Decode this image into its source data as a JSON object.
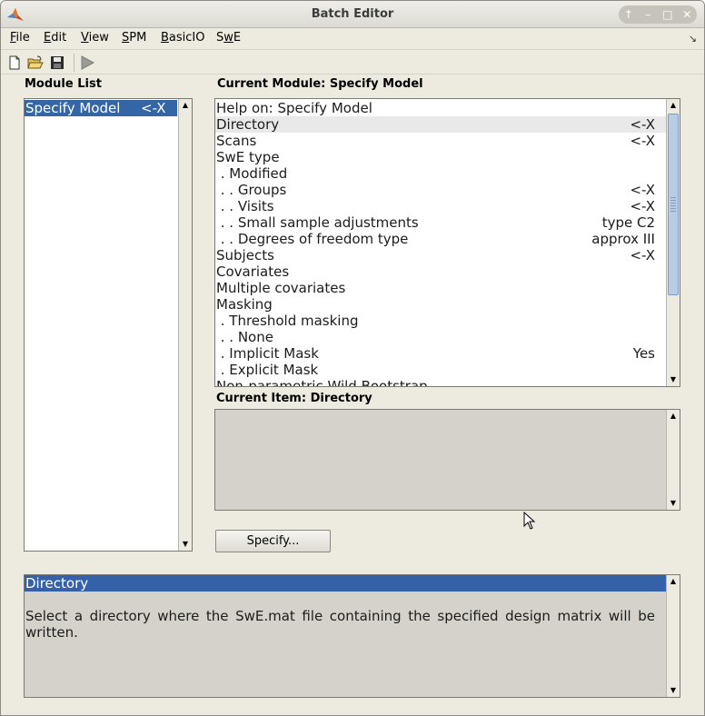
{
  "window": {
    "title": "Batch Editor",
    "controls": [
      "up-icon",
      "minimize-icon",
      "maximize-icon",
      "close-icon"
    ]
  },
  "menubar": {
    "items": [
      {
        "pre": "",
        "u": "F",
        "post": "ile"
      },
      {
        "pre": "",
        "u": "E",
        "post": "dit"
      },
      {
        "pre": "",
        "u": "V",
        "post": "iew"
      },
      {
        "pre": "",
        "u": "S",
        "post": "PM"
      },
      {
        "pre": "",
        "u": "B",
        "post": "asicIO"
      },
      {
        "pre": "S",
        "u": "w",
        "post": "E"
      }
    ]
  },
  "toolbar": {
    "icons": [
      "new-file-icon",
      "open-folder-icon",
      "save-icon",
      "run-icon"
    ]
  },
  "module_list": {
    "label": "Module List",
    "items": [
      {
        "label": "Specify Model",
        "value": "<-X",
        "selected": true
      }
    ]
  },
  "current_module": {
    "label": "Current Module: Specify Model",
    "rows": [
      {
        "label": "Help on: Specify Model",
        "value": ""
      },
      {
        "label": "Directory",
        "value": "<-X",
        "selected": true
      },
      {
        "label": "Scans",
        "value": "<-X"
      },
      {
        "label": "SwE type",
        "value": ""
      },
      {
        "label": " . Modified",
        "value": ""
      },
      {
        "label": " . . Groups",
        "value": "<-X"
      },
      {
        "label": " . . Visits",
        "value": "<-X"
      },
      {
        "label": " . . Small sample adjustments",
        "value": "type C2"
      },
      {
        "label": " . . Degrees of freedom type",
        "value": "approx III"
      },
      {
        "label": "Subjects",
        "value": "<-X"
      },
      {
        "label": "Covariates",
        "value": ""
      },
      {
        "label": "Multiple covariates",
        "value": ""
      },
      {
        "label": "Masking",
        "value": ""
      },
      {
        "label": " . Threshold masking",
        "value": ""
      },
      {
        "label": " . . None",
        "value": ""
      },
      {
        "label": " . Implicit Mask",
        "value": "Yes"
      },
      {
        "label": " . Explicit Mask",
        "value": ""
      },
      {
        "label": "Non-parametric Wild Bootstrap",
        "value": ""
      }
    ]
  },
  "current_item": {
    "label": "Current Item: Directory",
    "specify_label": "Specify..."
  },
  "help": {
    "title": "Directory",
    "text": "Select a directory where the SwE.mat file containing the specified design matrix will be written."
  }
}
